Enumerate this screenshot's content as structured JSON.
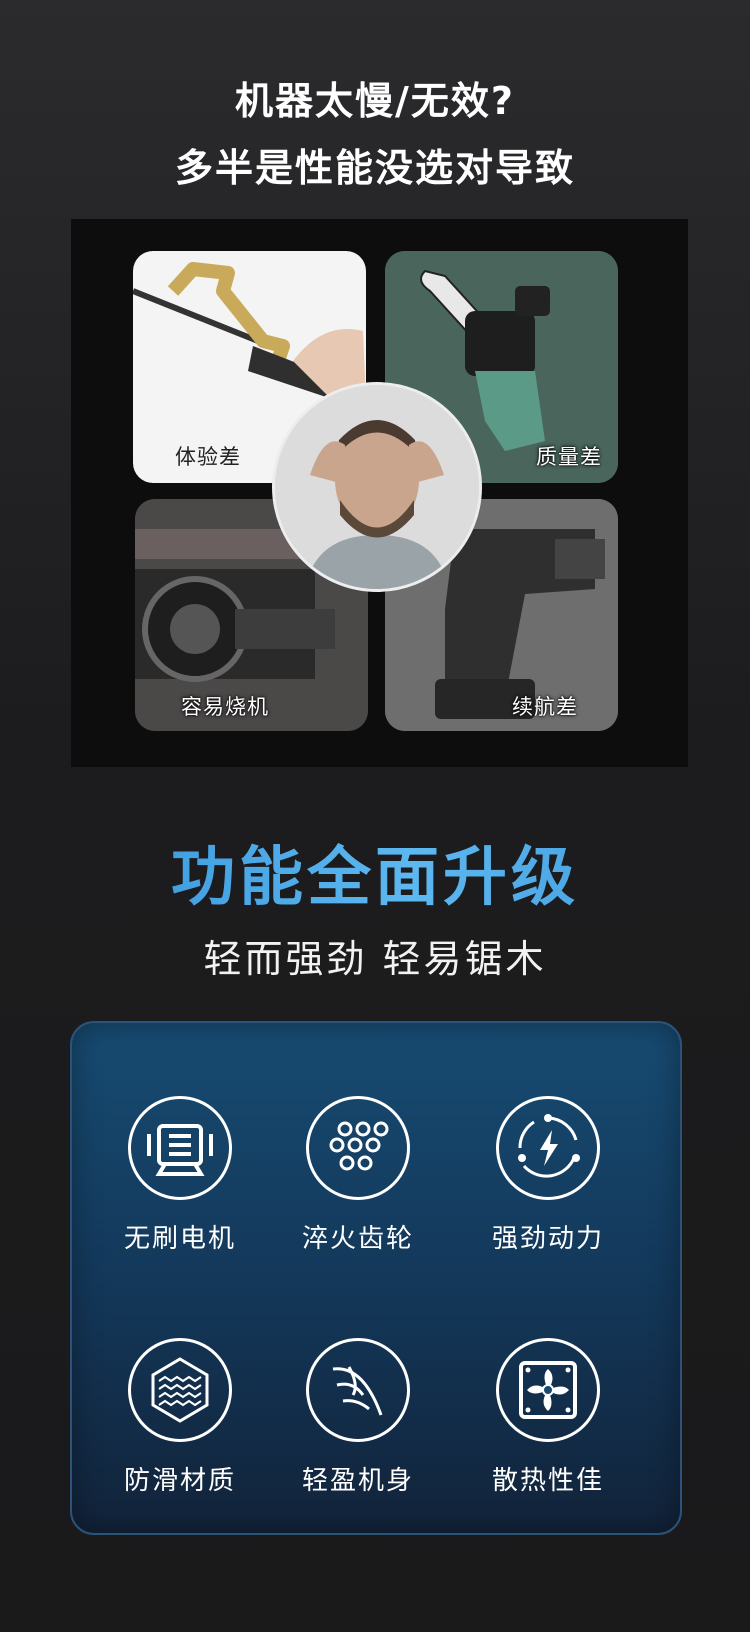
{
  "headline": {
    "line1": "机器太慢/无效?",
    "line2": "多半是性能没选对导致"
  },
  "problems": [
    {
      "label": "体验差",
      "icon": "hand-saw"
    },
    {
      "label": "质量差",
      "icon": "mini-chainsaw"
    },
    {
      "label": "容易烧机",
      "icon": "burnt-motor"
    },
    {
      "label": "续航差",
      "icon": "power-drill"
    }
  ],
  "upgrade": {
    "title": "功能全面升级",
    "subtitle": "轻而强劲  轻易锯木"
  },
  "features": [
    {
      "label": "无刷电机",
      "icon": "motor-icon"
    },
    {
      "label": "淬火齿轮",
      "icon": "gear-chain-icon"
    },
    {
      "label": "强劲动力",
      "icon": "power-cycle-icon"
    },
    {
      "label": "防滑材质",
      "icon": "anti-slip-texture-icon"
    },
    {
      "label": "轻盈机身",
      "icon": "feather-leaf-icon"
    },
    {
      "label": "散热性佳",
      "icon": "cooling-fan-icon"
    }
  ],
  "colors": {
    "accent_blue": "#3a9ae0",
    "panel_blue": "#174b72",
    "background": "#1c1c1e"
  }
}
